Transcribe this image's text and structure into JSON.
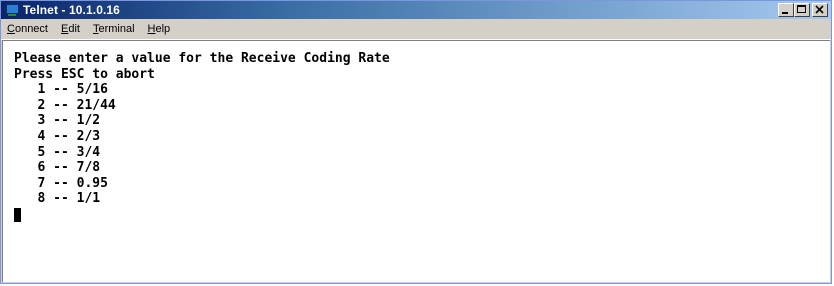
{
  "window": {
    "title": "Telnet - 10.1.0.16"
  },
  "menu": {
    "items": [
      {
        "accel": "C",
        "rest": "onnect"
      },
      {
        "accel": "E",
        "rest": "dit"
      },
      {
        "accel": "T",
        "rest": "erminal"
      },
      {
        "accel": "H",
        "rest": "elp"
      }
    ]
  },
  "terminal": {
    "prompt": "Please enter a value for the Receive Coding Rate",
    "abort_hint": "Press ESC to abort",
    "options": [
      "   1 -- 5/16",
      "   2 -- 21/44",
      "   3 -- 1/2",
      "   4 -- 2/3",
      "   5 -- 3/4",
      "   6 -- 7/8",
      "   7 -- 0.95",
      "   8 -- 1/1"
    ]
  },
  "colors": {
    "titlebar_start": "#0a246a",
    "titlebar_end": "#a6caf0",
    "chrome": "#d4d0c8",
    "terminal_bg": "#ffffff",
    "terminal_fg": "#000000"
  },
  "icons": {
    "app": "telnet-computer-icon",
    "minimize": "minimize-icon",
    "maximize": "maximize-icon",
    "close": "close-icon"
  }
}
